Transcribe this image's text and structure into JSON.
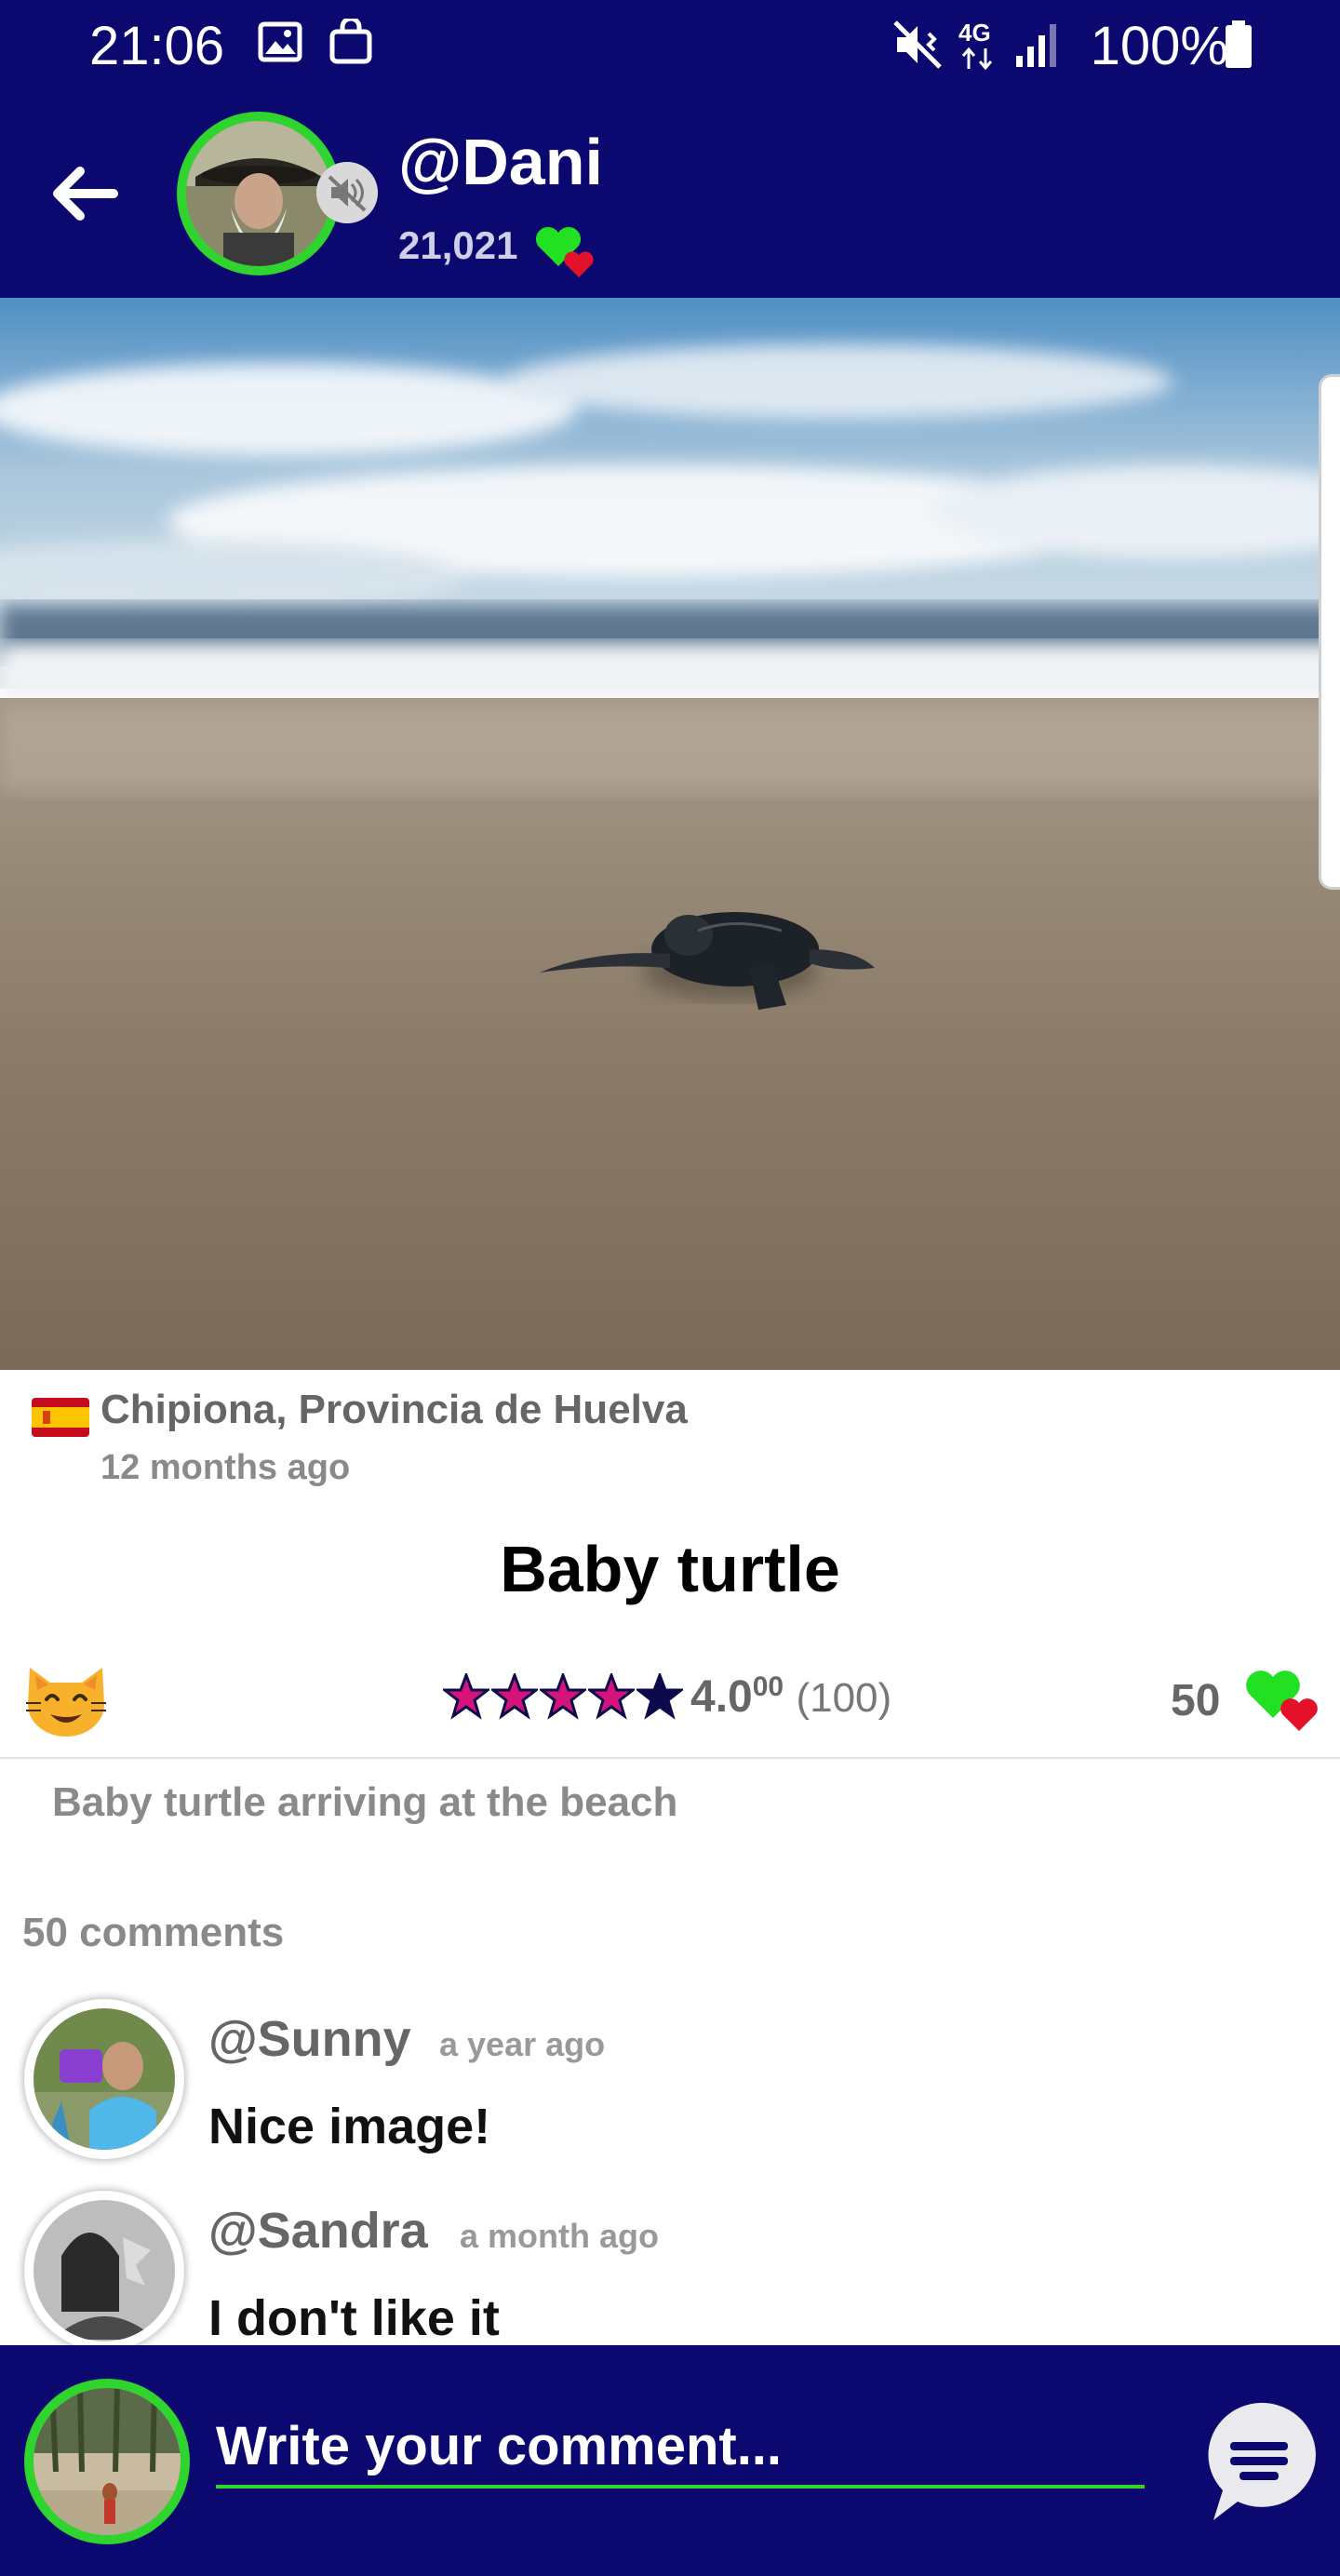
{
  "status_bar": {
    "time": "21:06",
    "network": "4G",
    "battery": "100%"
  },
  "header": {
    "username": "@Dani",
    "likes": "21,021"
  },
  "post": {
    "location": "Chipiona, Provincia de Huelva",
    "time_ago": "12 months ago",
    "title": "Baby turtle",
    "rating_value": "4.0",
    "rating_decimals": "00",
    "rating_count": "(100)",
    "rating_stars": 4,
    "likes": "50",
    "description": "Baby turtle arriving at the beach"
  },
  "comments_count": "50 comments",
  "comments": [
    {
      "user": "@Sunny",
      "time": "a year ago",
      "text": "Nice image!"
    },
    {
      "user": "@Sandra",
      "time": "a month ago",
      "text": "I don't like it"
    }
  ],
  "composer": {
    "placeholder": "Write your comment..."
  },
  "colors": {
    "bar": "#0b0870",
    "accent_green": "#2fd42f",
    "star_pink": "#d4147a",
    "star_dark": "#0b0a4a"
  }
}
